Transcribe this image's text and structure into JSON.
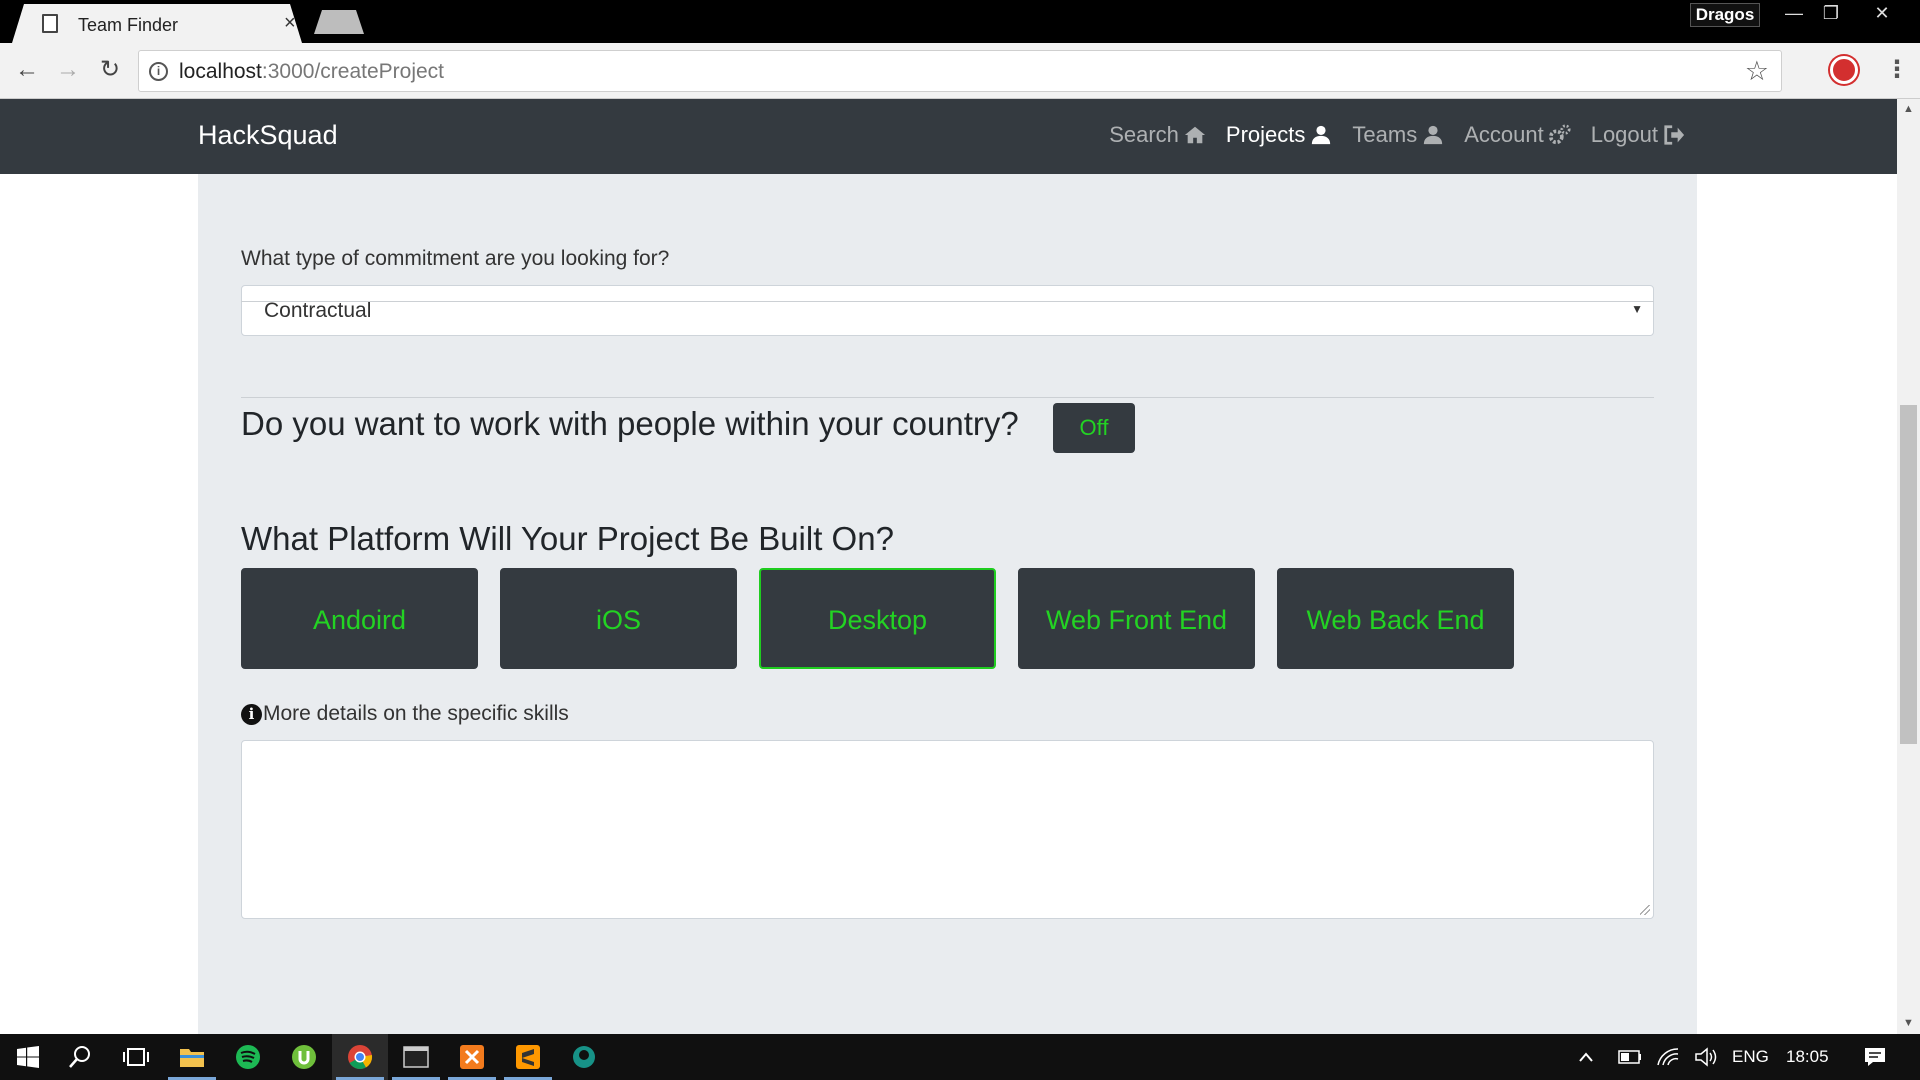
{
  "browser": {
    "tab_title": "Team Finder",
    "tab_close": "×",
    "profile_name": "Dragos",
    "url_host": "localhost",
    "url_path": ":3000/createProject"
  },
  "navbar": {
    "brand": "HackSquad",
    "links": [
      {
        "label": "Search",
        "icon": "home-icon"
      },
      {
        "label": "Projects",
        "icon": "user-icon",
        "active": true
      },
      {
        "label": "Teams",
        "icon": "user-icon"
      },
      {
        "label": "Account",
        "icon": "gears-icon"
      },
      {
        "label": "Logout",
        "icon": "sign-out-icon"
      }
    ]
  },
  "form": {
    "commitment_label": "What type of commitment are you looking for?",
    "commitment_value": "Contractual",
    "country_question": "Do you want to work with people within your country?",
    "country_toggle": "Off",
    "platform_question": "What Platform Will Your Project Be Built On?",
    "platforms": [
      {
        "label": "Andoird",
        "selected": false
      },
      {
        "label": "iOS",
        "selected": false
      },
      {
        "label": "Desktop",
        "selected": true
      },
      {
        "label": "Web Front End",
        "selected": false
      },
      {
        "label": "Web Back End",
        "selected": false
      }
    ],
    "details_label": "More details on the specific skills",
    "details_value": ""
  },
  "taskbar": {
    "language": "ENG",
    "time": "18:05"
  },
  "colors": {
    "navbar_bg": "#343a40",
    "card_bg": "#e9ecef",
    "accent_green": "#23d323"
  }
}
